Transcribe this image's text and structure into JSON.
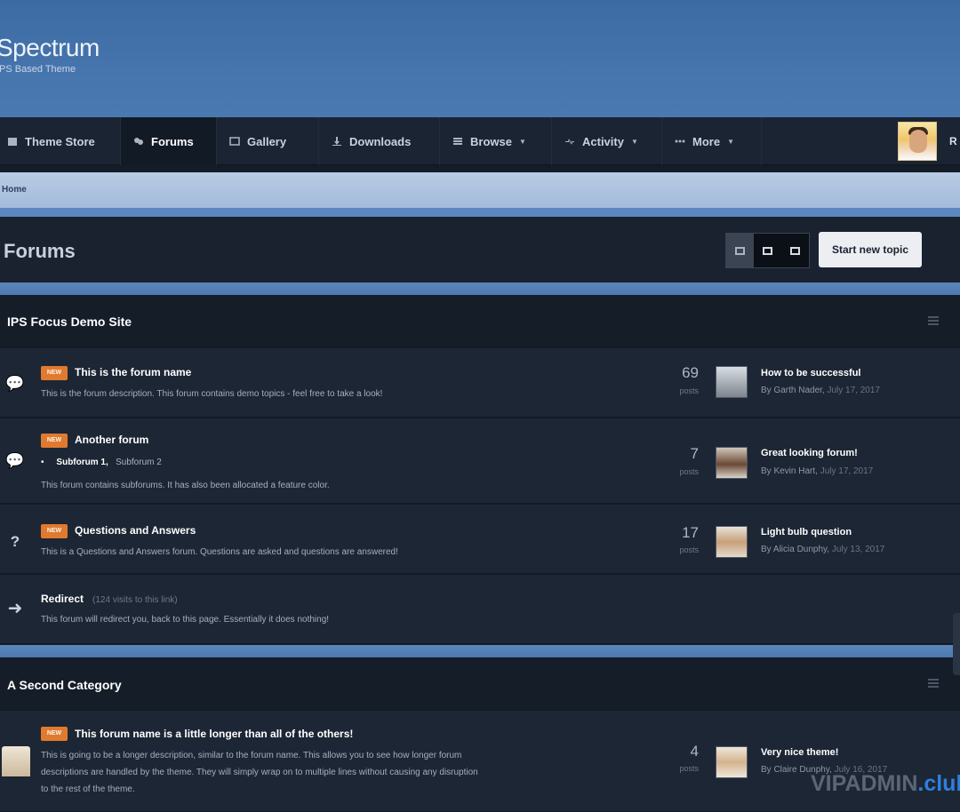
{
  "header": {
    "site_name": "Spectrum",
    "tagline": "IPS Based Theme"
  },
  "nav": {
    "items": [
      {
        "label": "Theme Store",
        "icon": "store-icon",
        "dropdown": false,
        "active": false
      },
      {
        "label": "Forums",
        "icon": "forums-icon",
        "dropdown": false,
        "active": true
      },
      {
        "label": "Gallery",
        "icon": "gallery-icon",
        "dropdown": false,
        "active": false
      },
      {
        "label": "Downloads",
        "icon": "download-icon",
        "dropdown": false,
        "active": false
      },
      {
        "label": "Browse",
        "icon": "list-icon",
        "dropdown": true,
        "active": false
      },
      {
        "label": "Activity",
        "icon": "activity-icon",
        "dropdown": true,
        "active": false
      },
      {
        "label": "More",
        "icon": "more-icon",
        "dropdown": true,
        "active": false
      }
    ],
    "user_label": "R"
  },
  "breadcrumb": {
    "home": "Home"
  },
  "page": {
    "title": "Forums",
    "start_topic": "Start new topic",
    "view_modes": [
      "table-view",
      "grid-view",
      "fluid-view"
    ]
  },
  "categories": [
    {
      "title": "IPS Focus Demo Site",
      "forums": [
        {
          "badge": "NEW",
          "name": "This is the forum name",
          "desc": "This is the forum description. This forum contains demo topics - feel free to take a look!",
          "count": "69",
          "count_label": "posts",
          "last_title": "How to be successful",
          "last_by": "By Garth Nader,",
          "last_date": "July 17, 2017",
          "icon": "chat-icon"
        },
        {
          "badge": "NEW",
          "name": "Another forum",
          "subforums": [
            "Subforum 1,",
            "Subforum 2"
          ],
          "desc": "This forum contains subforums. It has also been allocated a feature color.",
          "count": "7",
          "count_label": "posts",
          "last_title": "Great looking forum!",
          "last_by": "By Kevin Hart,",
          "last_date": "July 17, 2017",
          "icon": "chat-icon"
        },
        {
          "badge": "NEW",
          "name": "Questions and Answers",
          "desc": "This is a Questions and Answers forum. Questions are asked and questions are answered!",
          "count": "17",
          "count_label": "posts",
          "last_title": "Light bulb question",
          "last_by": "By Alicia Dunphy,",
          "last_date": "July 13, 2017",
          "icon": "question-icon"
        },
        {
          "name": "Redirect",
          "redirect_note": "(124 visits to this link)",
          "desc": "This forum will redirect you, back to this page. Essentially it does nothing!",
          "icon": "redirect-arrow-icon"
        }
      ]
    },
    {
      "title": "A Second Category",
      "forums": [
        {
          "badge": "NEW",
          "name": "This forum name is a little longer than all of the others!",
          "desc_lines": [
            "This is going to be a longer description, similar to the forum name. This allows you to see how longer forum",
            "descriptions are handled by the theme. They will simply wrap on to multiple lines without causing any disruption",
            "to the rest of the theme."
          ],
          "count": "4",
          "count_label": "posts",
          "last_title": "Very nice theme!",
          "last_by": "By Claire Dunphy,",
          "last_date": "July 16, 2017",
          "icon": "store-house-icon"
        }
      ]
    }
  ],
  "watermark": {
    "part1": "VIPADMIN",
    "part2": ".club"
  }
}
